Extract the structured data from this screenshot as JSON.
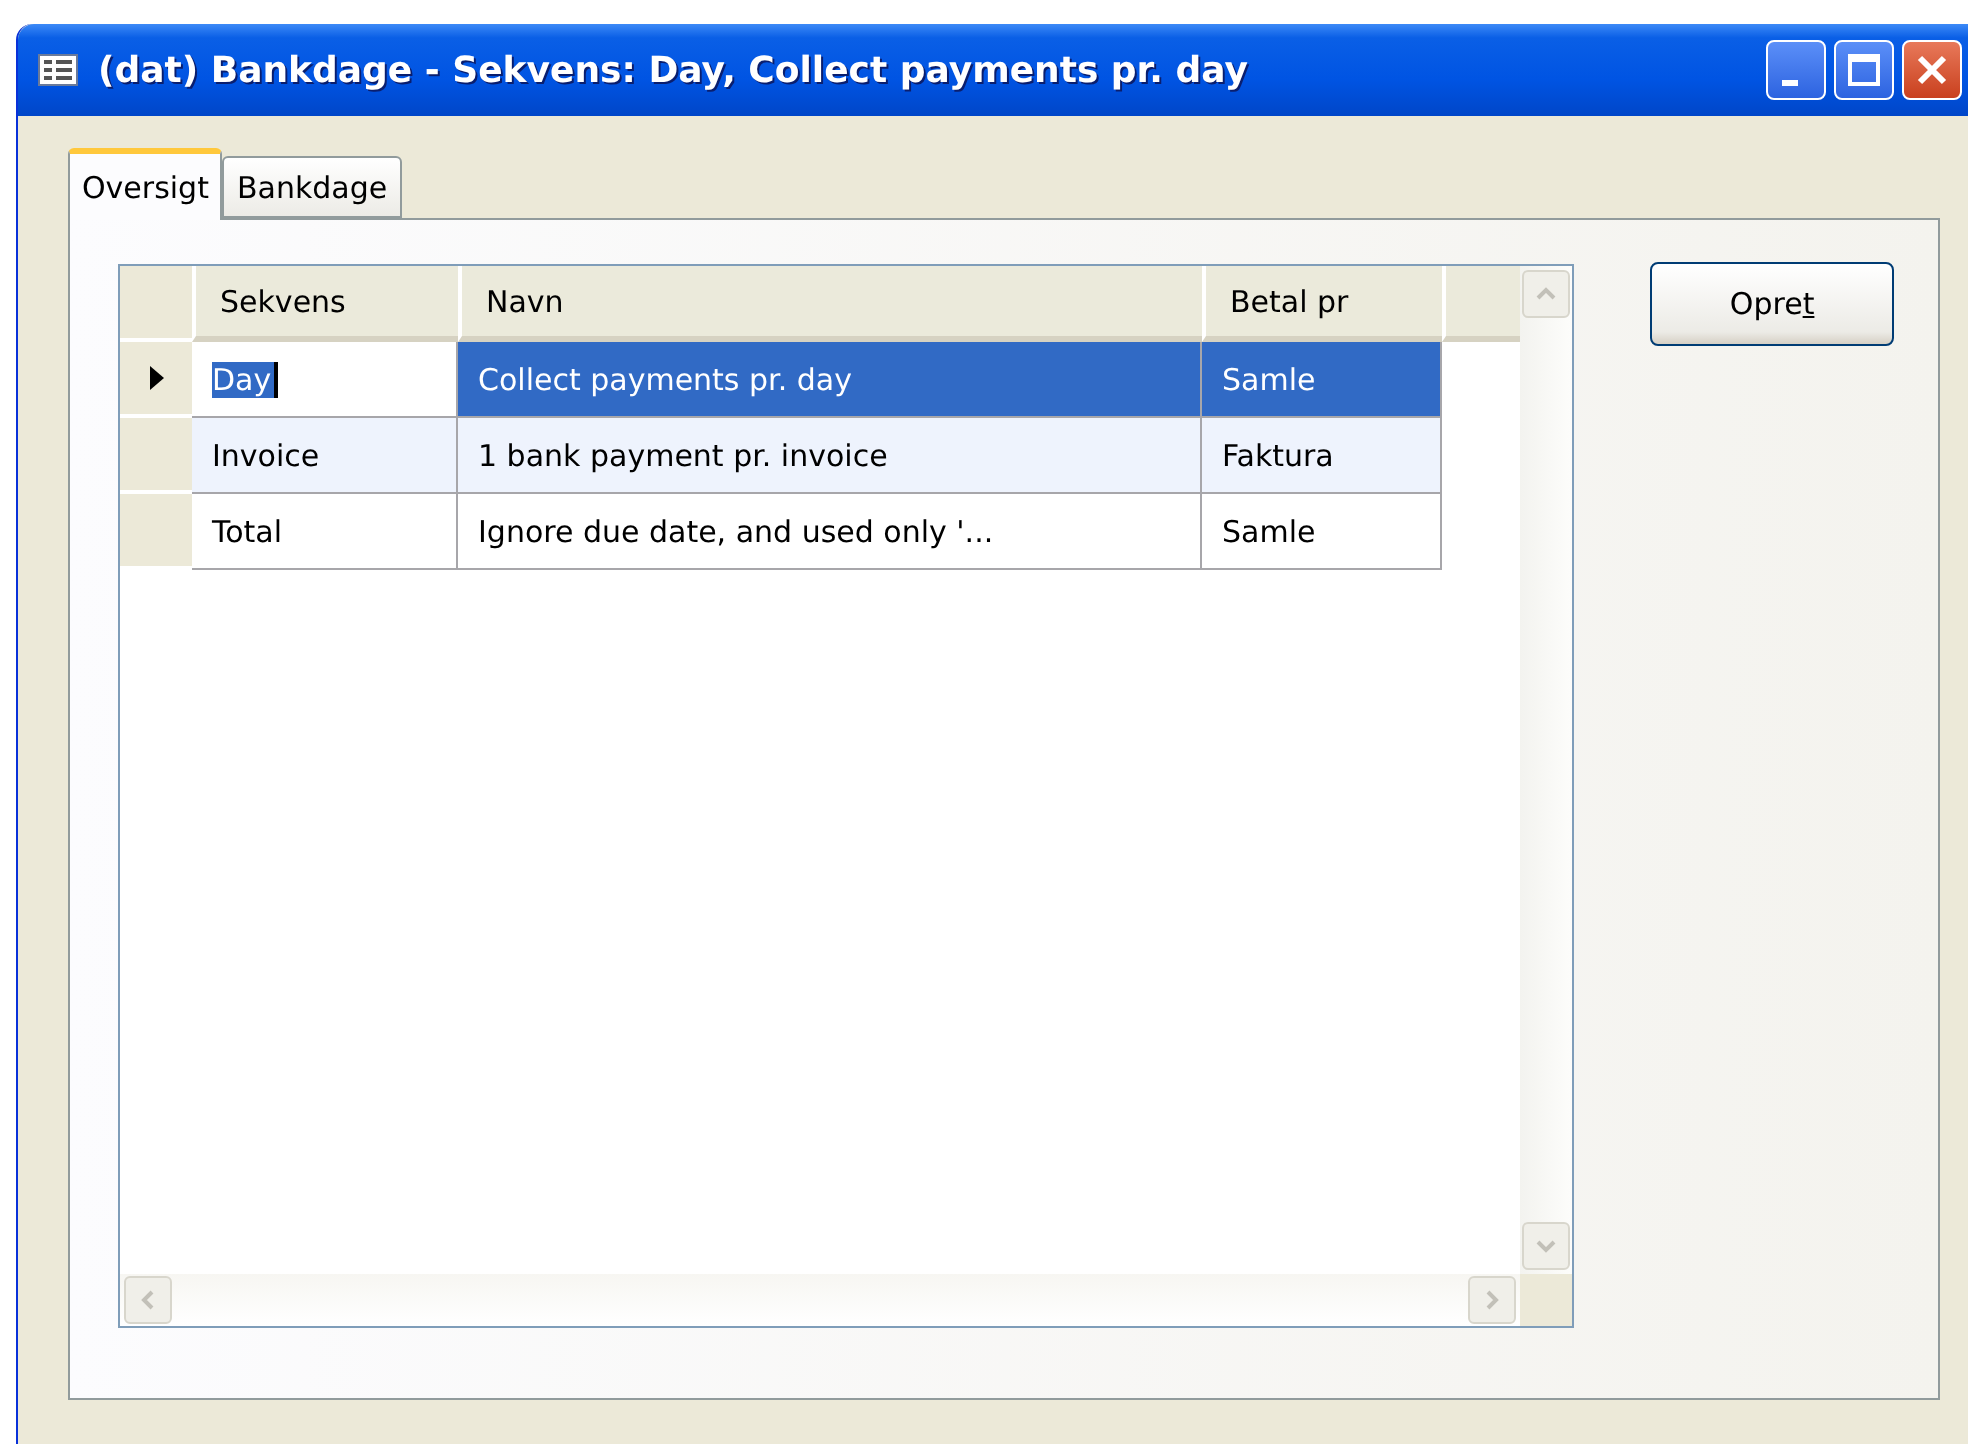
{
  "window": {
    "title": "(dat) Bankdage - Sekvens: Day, Collect payments pr. day"
  },
  "tabs": [
    {
      "label": "Oversigt",
      "selected": true
    },
    {
      "label": "Bankdage",
      "selected": false
    }
  ],
  "table": {
    "columns": [
      "Sekvens",
      "Navn",
      "Betal pr"
    ],
    "rows": [
      {
        "cells": [
          "Day",
          "Collect payments pr. day",
          "Samle"
        ],
        "selected": true
      },
      {
        "cells": [
          "Invoice",
          "1 bank payment pr. invoice",
          "Faktura"
        ],
        "selected": false
      },
      {
        "cells": [
          "Total",
          "Ignore due date, and used only '...",
          "Samle"
        ],
        "selected": false
      }
    ]
  },
  "button": {
    "text": "Opre",
    "access_key": "t"
  }
}
